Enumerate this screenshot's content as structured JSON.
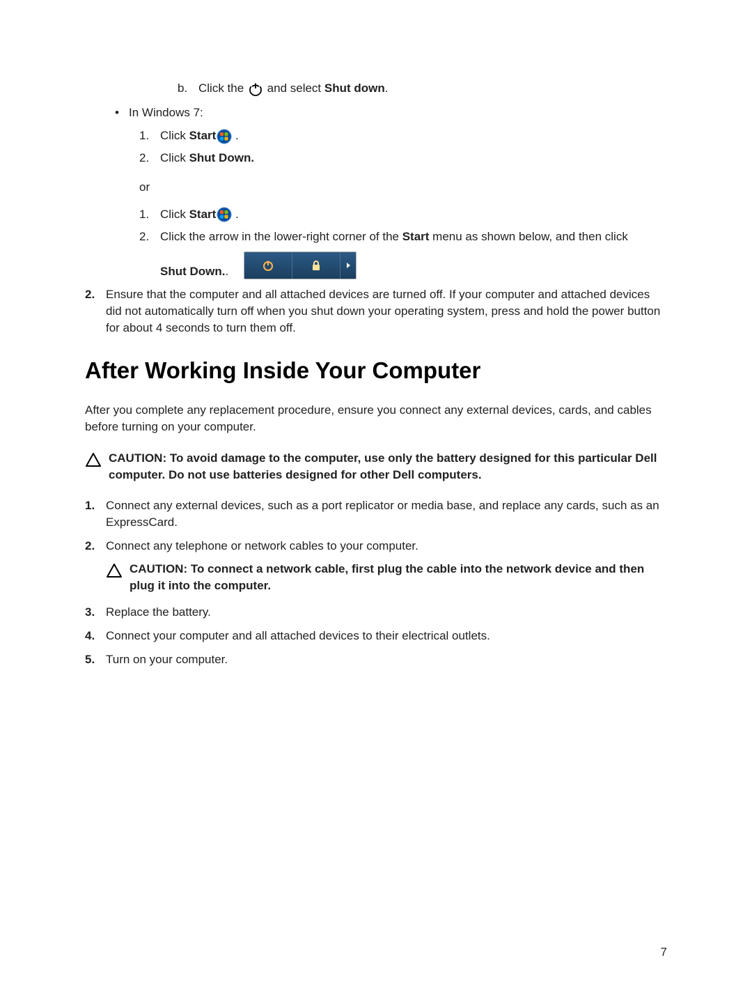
{
  "lettered": {
    "b": {
      "letter": "b.",
      "pre": "Click the ",
      "post": " and select ",
      "target": "Shut down",
      "tail": "."
    }
  },
  "bullet1": "In Windows 7:",
  "win7_a": {
    "n1": "1.",
    "n1_text_pre": "Click ",
    "n1_target": "Start",
    "n1_post": " .",
    "n2": "2.",
    "n2_text_pre": "Click ",
    "n2_target": "Shut Down."
  },
  "or": "or",
  "win7_b": {
    "n1": "1.",
    "n1_text_pre": "Click ",
    "n1_target": "Start",
    "n1_post": " .",
    "n2": "2.",
    "n2_text_pre": "Click the arrow in the lower-right corner of the ",
    "n2_bold": "Start",
    "n2_text_post": " menu as shown below, and then click",
    "shut": "Shut Down.",
    "shut_tail": "."
  },
  "step2": {
    "num": "2.",
    "text": "Ensure that the computer and all attached devices are turned off. If your computer and attached devices did not automatically turn off when you shut down your operating system, press and hold the power button for about 4 seconds to turn them off."
  },
  "heading": "After Working Inside Your Computer",
  "intro": "After you complete any replacement procedure, ensure you connect any external devices, cards, and cables before turning on your computer.",
  "caution1": "CAUTION: To avoid damage to the computer, use only the battery designed for this particular Dell computer. Do not use batteries designed for other Dell computers.",
  "list": {
    "n1": "1.",
    "t1": "Connect any external devices, such as a port replicator or media base, and replace any cards, such as an ExpressCard.",
    "n2": "2.",
    "t2": "Connect any telephone or network cables to your computer.",
    "caution2": "CAUTION: To connect a network cable, first plug the cable into the network device and then plug it into the computer.",
    "n3": "3.",
    "t3": "Replace the battery.",
    "n4": "4.",
    "t4": "Connect your computer and all attached devices to their electrical outlets.",
    "n5": "5.",
    "t5": "Turn on your computer."
  },
  "page_number": "7"
}
